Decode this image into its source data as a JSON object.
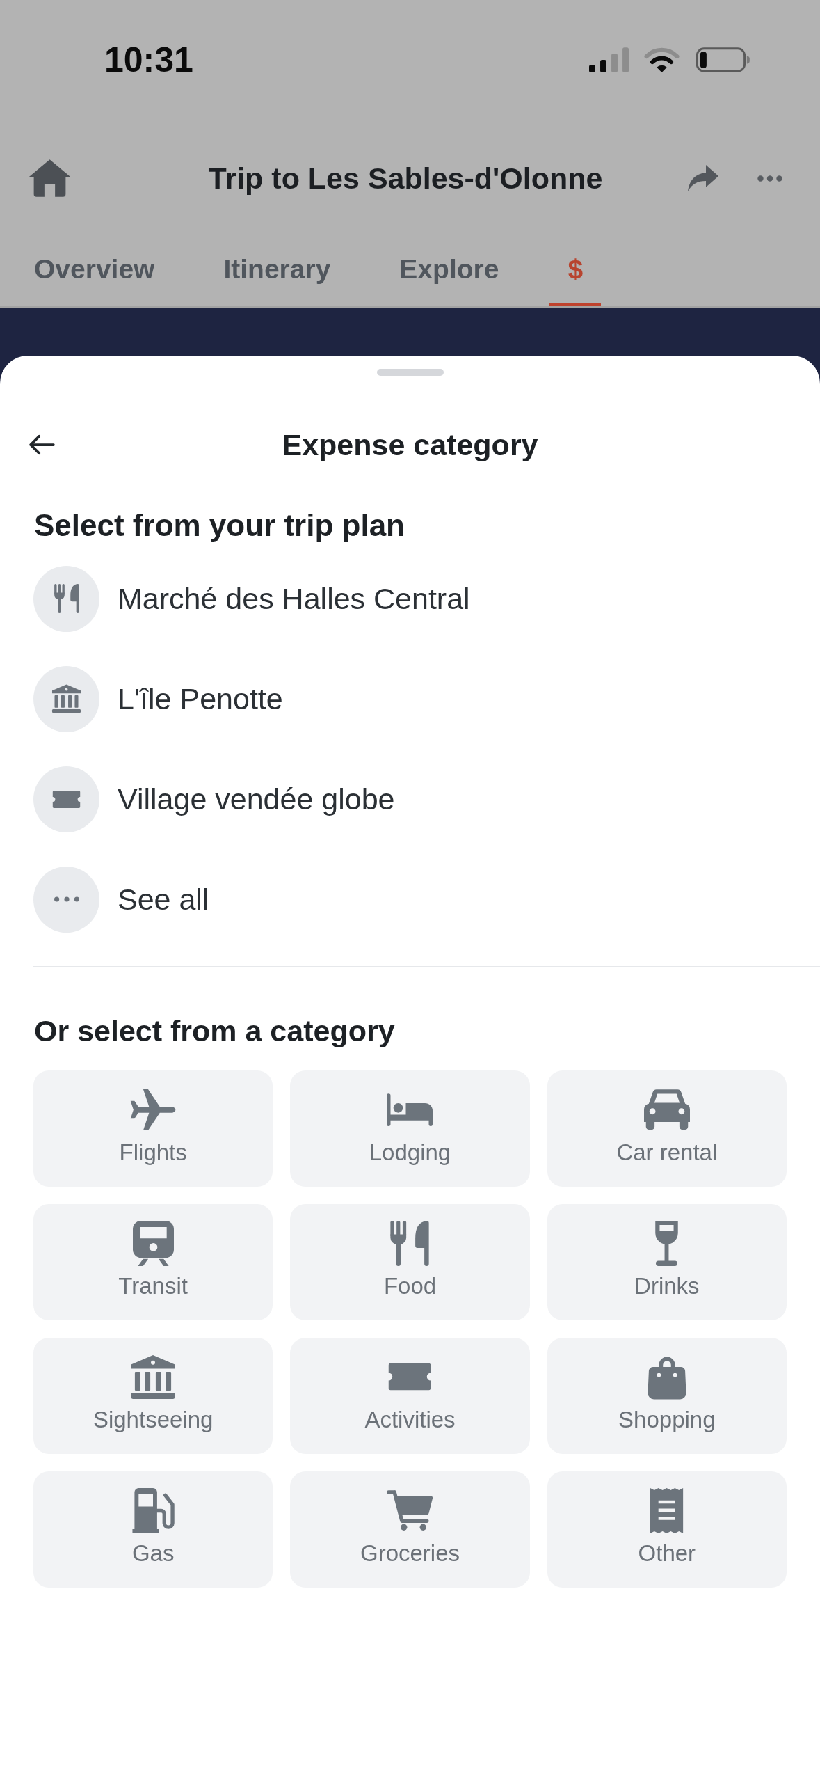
{
  "status_bar": {
    "time": "10:31"
  },
  "header": {
    "title": "Trip to Les Sables-d'Olonne"
  },
  "tabs": [
    {
      "label": "Overview",
      "selected": false
    },
    {
      "label": "Itinerary",
      "selected": false
    },
    {
      "label": "Explore",
      "selected": false
    },
    {
      "label": "$",
      "selected": true
    }
  ],
  "sheet": {
    "title": "Expense category",
    "trip_plan": {
      "heading": "Select from your trip plan",
      "items": [
        {
          "label": "Marché des Halles Central",
          "kind": "food"
        },
        {
          "label": "L'île Penotte",
          "kind": "sightseeing"
        },
        {
          "label": "Village vendée globe",
          "kind": "activities"
        },
        {
          "label": "See all",
          "kind": "more"
        }
      ]
    },
    "categories": {
      "heading": "Or select from a category",
      "items": [
        {
          "label": "Flights",
          "kind": "flights"
        },
        {
          "label": "Lodging",
          "kind": "lodging"
        },
        {
          "label": "Car rental",
          "kind": "car"
        },
        {
          "label": "Transit",
          "kind": "transit"
        },
        {
          "label": "Food",
          "kind": "food"
        },
        {
          "label": "Drinks",
          "kind": "drinks"
        },
        {
          "label": "Sightseeing",
          "kind": "sightseeing"
        },
        {
          "label": "Activities",
          "kind": "activities"
        },
        {
          "label": "Shopping",
          "kind": "shopping"
        },
        {
          "label": "Gas",
          "kind": "gas"
        },
        {
          "label": "Groceries",
          "kind": "groceries"
        },
        {
          "label": "Other",
          "kind": "other"
        }
      ]
    }
  }
}
